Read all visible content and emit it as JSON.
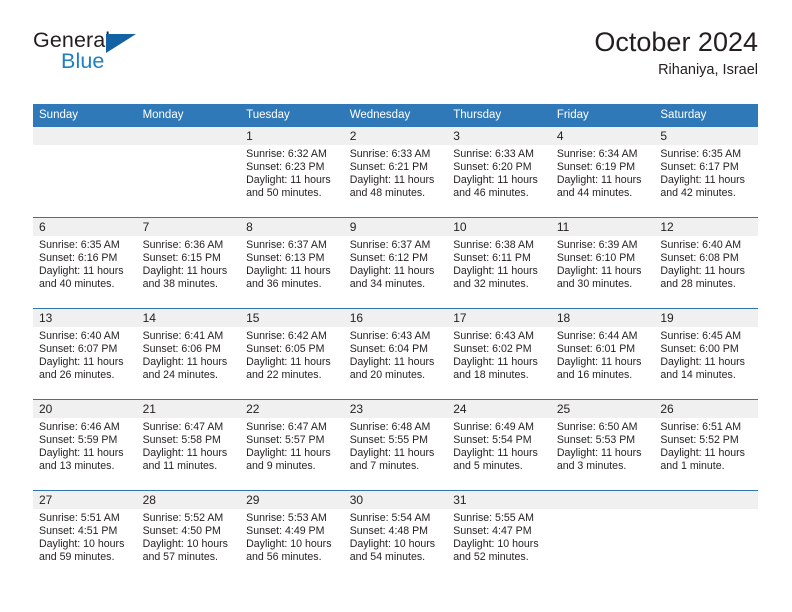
{
  "brand": {
    "line1": "General",
    "line2": "Blue",
    "accent_color": "#1362a4",
    "text_color": "#231f20"
  },
  "header": {
    "title": "October 2024",
    "subtitle": "Rihaniya, Israel"
  },
  "theme": {
    "header_blue": "#3079b8",
    "row_rule_blue": "#2f76b5",
    "daynum_band": "#f0f0f0",
    "page_background": "#ffffff"
  },
  "calendar": {
    "weekday_headers": [
      "Sunday",
      "Monday",
      "Tuesday",
      "Wednesday",
      "Thursday",
      "Friday",
      "Saturday"
    ],
    "labels": {
      "sunrise": "Sunrise:",
      "sunset": "Sunset:",
      "daylight": "Daylight:"
    },
    "weeks": [
      [
        {
          "day": "",
          "sunrise": "",
          "sunset": "",
          "daylight": ""
        },
        {
          "day": "",
          "sunrise": "",
          "sunset": "",
          "daylight": ""
        },
        {
          "day": "1",
          "sunrise": "Sunrise: 6:32 AM",
          "sunset": "Sunset: 6:23 PM",
          "daylight": "Daylight: 11 hours and 50 minutes."
        },
        {
          "day": "2",
          "sunrise": "Sunrise: 6:33 AM",
          "sunset": "Sunset: 6:21 PM",
          "daylight": "Daylight: 11 hours and 48 minutes."
        },
        {
          "day": "3",
          "sunrise": "Sunrise: 6:33 AM",
          "sunset": "Sunset: 6:20 PM",
          "daylight": "Daylight: 11 hours and 46 minutes."
        },
        {
          "day": "4",
          "sunrise": "Sunrise: 6:34 AM",
          "sunset": "Sunset: 6:19 PM",
          "daylight": "Daylight: 11 hours and 44 minutes."
        },
        {
          "day": "5",
          "sunrise": "Sunrise: 6:35 AM",
          "sunset": "Sunset: 6:17 PM",
          "daylight": "Daylight: 11 hours and 42 minutes."
        }
      ],
      [
        {
          "day": "6",
          "sunrise": "Sunrise: 6:35 AM",
          "sunset": "Sunset: 6:16 PM",
          "daylight": "Daylight: 11 hours and 40 minutes."
        },
        {
          "day": "7",
          "sunrise": "Sunrise: 6:36 AM",
          "sunset": "Sunset: 6:15 PM",
          "daylight": "Daylight: 11 hours and 38 minutes."
        },
        {
          "day": "8",
          "sunrise": "Sunrise: 6:37 AM",
          "sunset": "Sunset: 6:13 PM",
          "daylight": "Daylight: 11 hours and 36 minutes."
        },
        {
          "day": "9",
          "sunrise": "Sunrise: 6:37 AM",
          "sunset": "Sunset: 6:12 PM",
          "daylight": "Daylight: 11 hours and 34 minutes."
        },
        {
          "day": "10",
          "sunrise": "Sunrise: 6:38 AM",
          "sunset": "Sunset: 6:11 PM",
          "daylight": "Daylight: 11 hours and 32 minutes."
        },
        {
          "day": "11",
          "sunrise": "Sunrise: 6:39 AM",
          "sunset": "Sunset: 6:10 PM",
          "daylight": "Daylight: 11 hours and 30 minutes."
        },
        {
          "day": "12",
          "sunrise": "Sunrise: 6:40 AM",
          "sunset": "Sunset: 6:08 PM",
          "daylight": "Daylight: 11 hours and 28 minutes."
        }
      ],
      [
        {
          "day": "13",
          "sunrise": "Sunrise: 6:40 AM",
          "sunset": "Sunset: 6:07 PM",
          "daylight": "Daylight: 11 hours and 26 minutes."
        },
        {
          "day": "14",
          "sunrise": "Sunrise: 6:41 AM",
          "sunset": "Sunset: 6:06 PM",
          "daylight": "Daylight: 11 hours and 24 minutes."
        },
        {
          "day": "15",
          "sunrise": "Sunrise: 6:42 AM",
          "sunset": "Sunset: 6:05 PM",
          "daylight": "Daylight: 11 hours and 22 minutes."
        },
        {
          "day": "16",
          "sunrise": "Sunrise: 6:43 AM",
          "sunset": "Sunset: 6:04 PM",
          "daylight": "Daylight: 11 hours and 20 minutes."
        },
        {
          "day": "17",
          "sunrise": "Sunrise: 6:43 AM",
          "sunset": "Sunset: 6:02 PM",
          "daylight": "Daylight: 11 hours and 18 minutes."
        },
        {
          "day": "18",
          "sunrise": "Sunrise: 6:44 AM",
          "sunset": "Sunset: 6:01 PM",
          "daylight": "Daylight: 11 hours and 16 minutes."
        },
        {
          "day": "19",
          "sunrise": "Sunrise: 6:45 AM",
          "sunset": "Sunset: 6:00 PM",
          "daylight": "Daylight: 11 hours and 14 minutes."
        }
      ],
      [
        {
          "day": "20",
          "sunrise": "Sunrise: 6:46 AM",
          "sunset": "Sunset: 5:59 PM",
          "daylight": "Daylight: 11 hours and 13 minutes."
        },
        {
          "day": "21",
          "sunrise": "Sunrise: 6:47 AM",
          "sunset": "Sunset: 5:58 PM",
          "daylight": "Daylight: 11 hours and 11 minutes."
        },
        {
          "day": "22",
          "sunrise": "Sunrise: 6:47 AM",
          "sunset": "Sunset: 5:57 PM",
          "daylight": "Daylight: 11 hours and 9 minutes."
        },
        {
          "day": "23",
          "sunrise": "Sunrise: 6:48 AM",
          "sunset": "Sunset: 5:55 PM",
          "daylight": "Daylight: 11 hours and 7 minutes."
        },
        {
          "day": "24",
          "sunrise": "Sunrise: 6:49 AM",
          "sunset": "Sunset: 5:54 PM",
          "daylight": "Daylight: 11 hours and 5 minutes."
        },
        {
          "day": "25",
          "sunrise": "Sunrise: 6:50 AM",
          "sunset": "Sunset: 5:53 PM",
          "daylight": "Daylight: 11 hours and 3 minutes."
        },
        {
          "day": "26",
          "sunrise": "Sunrise: 6:51 AM",
          "sunset": "Sunset: 5:52 PM",
          "daylight": "Daylight: 11 hours and 1 minute."
        }
      ],
      [
        {
          "day": "27",
          "sunrise": "Sunrise: 5:51 AM",
          "sunset": "Sunset: 4:51 PM",
          "daylight": "Daylight: 10 hours and 59 minutes."
        },
        {
          "day": "28",
          "sunrise": "Sunrise: 5:52 AM",
          "sunset": "Sunset: 4:50 PM",
          "daylight": "Daylight: 10 hours and 57 minutes."
        },
        {
          "day": "29",
          "sunrise": "Sunrise: 5:53 AM",
          "sunset": "Sunset: 4:49 PM",
          "daylight": "Daylight: 10 hours and 56 minutes."
        },
        {
          "day": "30",
          "sunrise": "Sunrise: 5:54 AM",
          "sunset": "Sunset: 4:48 PM",
          "daylight": "Daylight: 10 hours and 54 minutes."
        },
        {
          "day": "31",
          "sunrise": "Sunrise: 5:55 AM",
          "sunset": "Sunset: 4:47 PM",
          "daylight": "Daylight: 10 hours and 52 minutes."
        },
        {
          "day": "",
          "sunrise": "",
          "sunset": "",
          "daylight": ""
        },
        {
          "day": "",
          "sunrise": "",
          "sunset": "",
          "daylight": ""
        }
      ]
    ]
  }
}
